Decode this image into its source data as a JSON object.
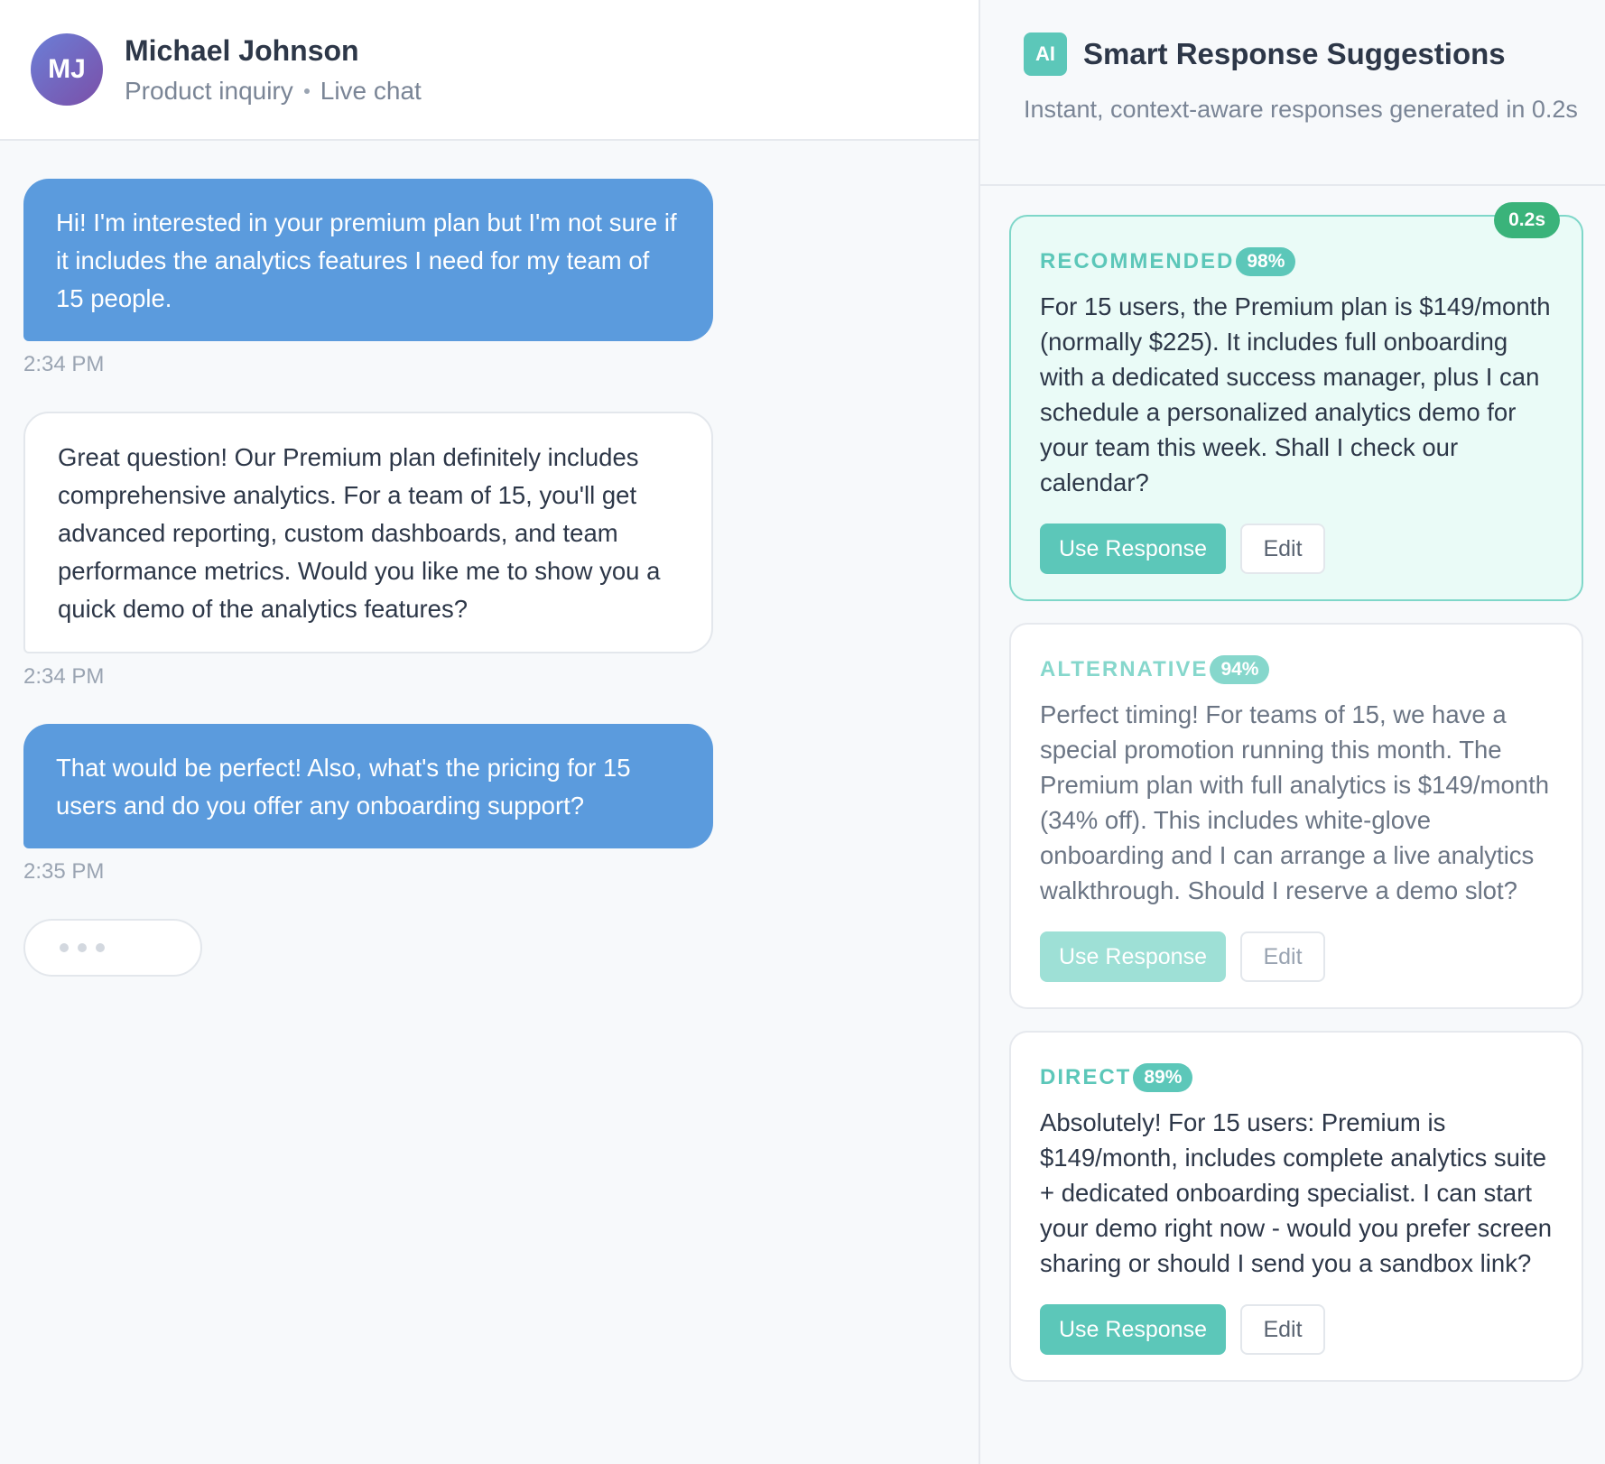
{
  "contact": {
    "initials": "MJ",
    "name": "Michael Johnson",
    "topic": "Product inquiry",
    "channel": "Live chat"
  },
  "messages": [
    {
      "sender": "customer",
      "text": "Hi! I'm interested in your premium plan but I'm not sure if it includes the analytics features I need for my team of 15 people.",
      "time": "2:34 PM"
    },
    {
      "sender": "agent",
      "text": "Great question! Our Premium plan definitely includes comprehensive analytics. For a team of 15, you'll get advanced reporting, custom dashboards, and team performance metrics. Would you like me to show you a quick demo of the analytics features?",
      "time": "2:34 PM"
    },
    {
      "sender": "customer",
      "text": "That would be perfect! Also, what's the pricing for 15 users and do you offer any onboarding support?",
      "time": "2:35 PM"
    }
  ],
  "suggestions_panel": {
    "badge": "AI",
    "title": "Smart Response Suggestions",
    "subtitle": "Instant, context-aware responses generated in 0.2s",
    "generation_time": "0.2s",
    "use_label": "Use Response",
    "edit_label": "Edit",
    "accent_color": "#5cc7b9",
    "cards": [
      {
        "label": "RECOMMENDED",
        "score": "98%",
        "text": "For 15 users, the Premium plan is $149/month (normally $225). It includes full onboarding with a dedicated success manager, plus I can schedule a personalized analytics demo for your team this week. Shall I check our calendar?"
      },
      {
        "label": "ALTERNATIVE",
        "score": "94%",
        "text": "Perfect timing! For teams of 15, we have a special promotion running this month. The Premium plan with full analytics is $149/month (34% off). This includes white-glove onboarding and I can arrange a live analytics walkthrough. Should I reserve a demo slot?"
      },
      {
        "label": "DIRECT",
        "score": "89%",
        "text": "Absolutely! For 15 users: Premium is $149/month, includes complete analytics suite + dedicated onboarding specialist. I can start your demo right now - would you prefer screen sharing or should I send you a sandbox link?"
      }
    ]
  }
}
